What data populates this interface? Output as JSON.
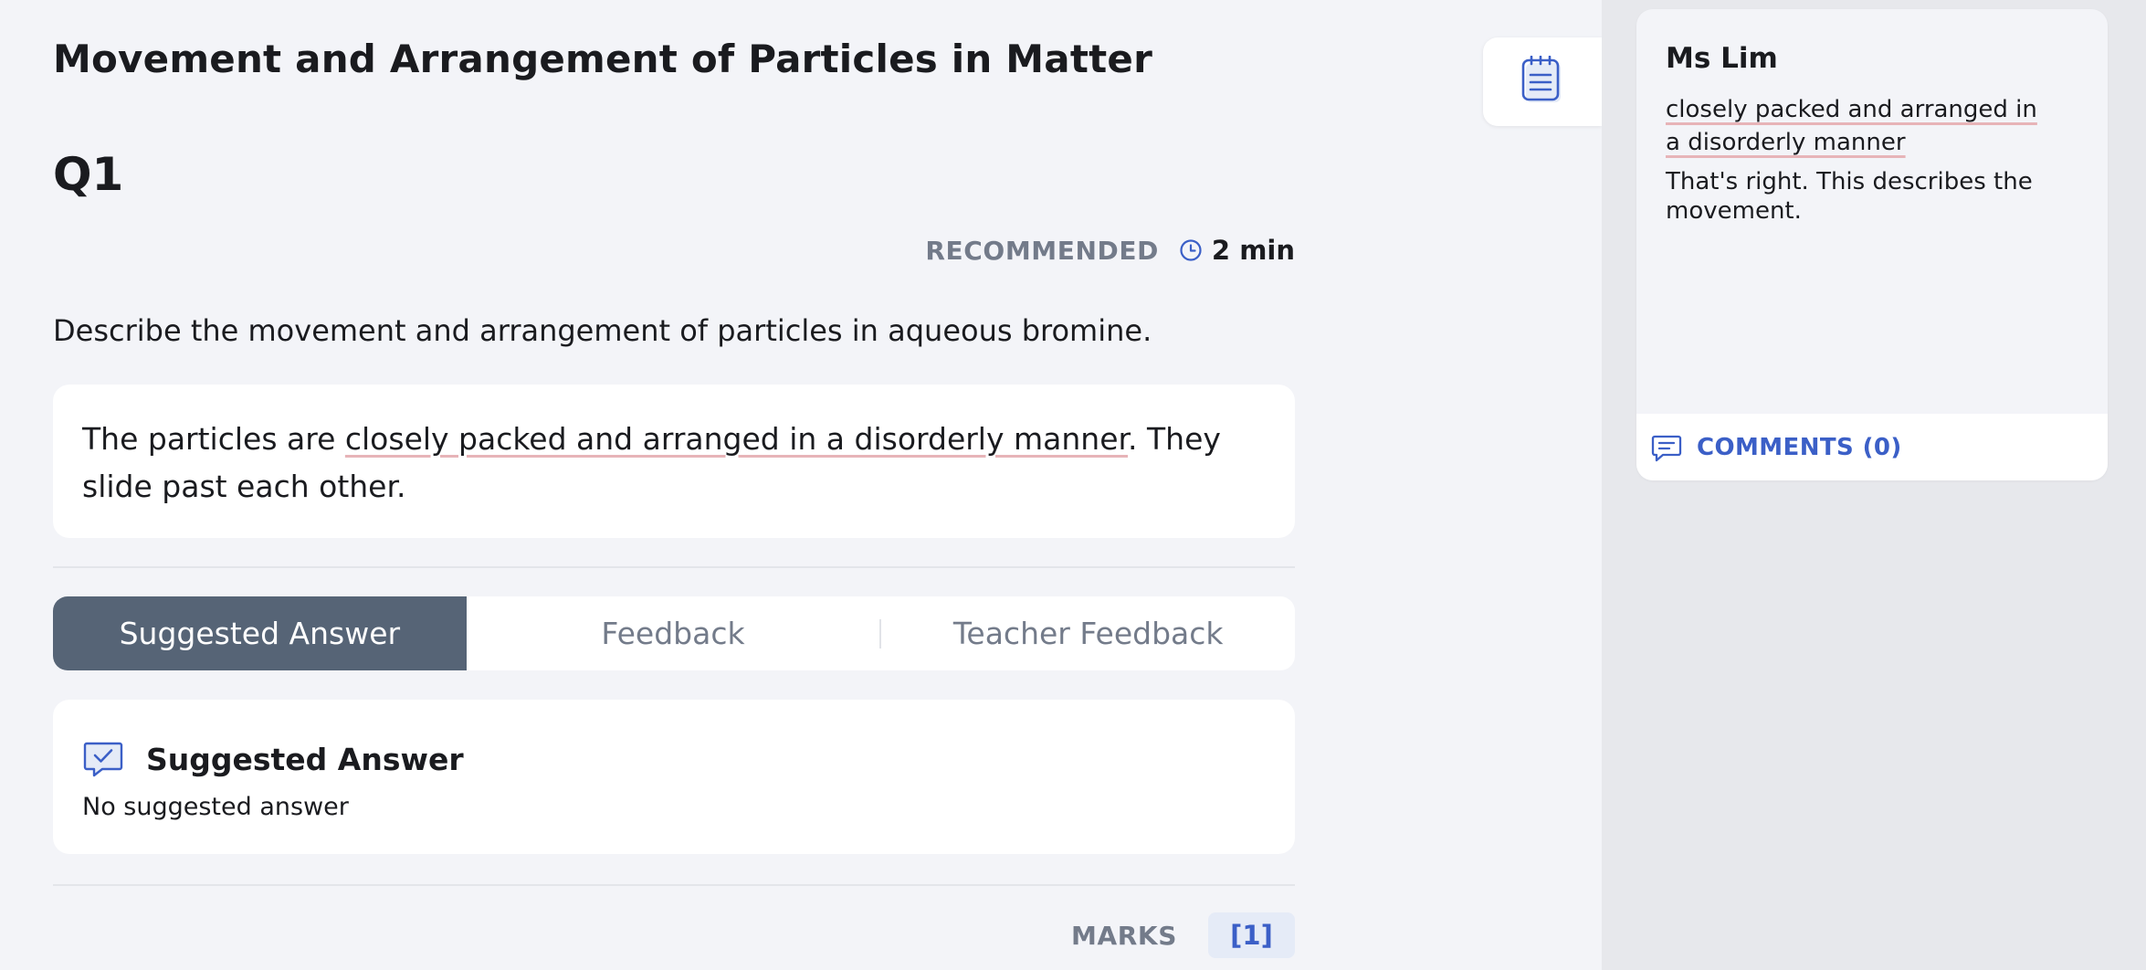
{
  "page": {
    "title": "Movement and Arrangement of Particles in Matter"
  },
  "question": {
    "label": "Q1",
    "recommended_label": "RECOMMENDED",
    "recommended_time": "2 min",
    "prompt": "Describe the movement and arrangement of particles in aqueous bromine.",
    "student_answer": {
      "before": "The particles are ",
      "highlight": "closely packed and arranged in a disorderly manner",
      "after": ". They slide past each other."
    }
  },
  "tabs": [
    {
      "label": "Suggested Answer",
      "active": true
    },
    {
      "label": "Feedback",
      "active": false
    },
    {
      "label": "Teacher Feedback",
      "active": false
    }
  ],
  "suggested_answer": {
    "title": "Suggested Answer",
    "body": "No suggested answer"
  },
  "marks": {
    "label": "MARKS",
    "value": "[1]"
  },
  "comment": {
    "author": "Ms Lim",
    "quoted_text": "closely packed and arranged in a disorderly manner",
    "reply": "That's right. This describes the movement.",
    "comments_label": "COMMENTS (0)"
  },
  "icons": {
    "notes": "notepad-icon",
    "clock": "clock-icon",
    "suggested": "chat-check-icon",
    "comments": "comment-lines-icon"
  },
  "colors": {
    "accent": "#3b5fc7",
    "active_tab": "#566476",
    "highlight_underline": "#e7b4b8",
    "muted_text": "#737b8a"
  }
}
